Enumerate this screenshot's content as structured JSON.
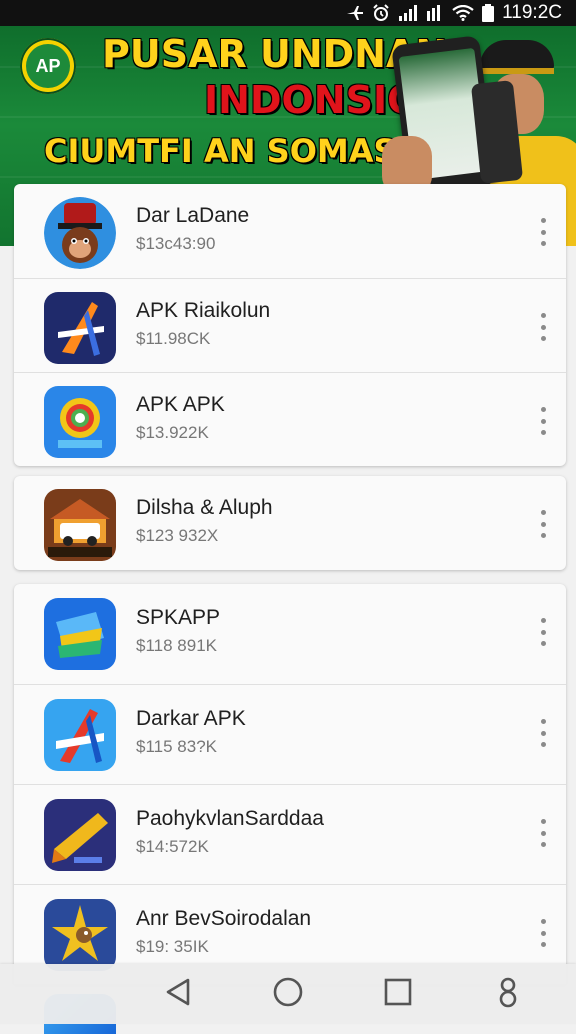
{
  "status_bar": {
    "time": "119:2C",
    "icons": [
      "airplane-icon",
      "alarm-icon",
      "signal-icon",
      "wifi-icon",
      "battery-icon"
    ],
    "background": "#111111"
  },
  "banner": {
    "logo_text": "AP",
    "line1": "PUSAR UNDNAN",
    "line2": "INDONSIO",
    "line3": "CIUMTFI AN SOMASSA!",
    "colors": {
      "background": "#178437",
      "line1": "#ffd21c",
      "line2": "#e0141b",
      "line3": "#ffd21c"
    }
  },
  "apps": [
    {
      "name": "Dar LaDane",
      "size": "$13c43:90",
      "icon": "monkey-hat-icon",
      "colors": [
        "#2f8fe0",
        "#7a3c1c"
      ]
    },
    {
      "name": "APK Riaikolun",
      "size": "$11.98CK",
      "icon": "arrow-a-icon",
      "colors": [
        "#1f2a6b",
        "#ff8a1c"
      ]
    },
    {
      "name": "APK APK",
      "size": "$13.922K",
      "icon": "chrome-ring-icon",
      "colors": [
        "#2a86e8",
        "#f2c618"
      ]
    },
    {
      "name": "Dilsha & Aluph",
      "size": "$123 932X",
      "icon": "truck-icon",
      "colors": [
        "#7a3c1a",
        "#f0a030"
      ]
    },
    {
      "name": "SPKAPP",
      "size": "$118 891K",
      "icon": "folder-fold-icon",
      "colors": [
        "#1e6fe0",
        "#f2c618"
      ]
    },
    {
      "name": "Darkar APK",
      "size": "$115 83?K",
      "icon": "arrow-a-blue-icon",
      "colors": [
        "#36a4f0",
        "#e53a2a"
      ]
    },
    {
      "name": "PaohykvlanSarddaa",
      "size": "$14:572K",
      "icon": "pencil-star-icon",
      "colors": [
        "#2b2f7a",
        "#f0b81c"
      ]
    },
    {
      "name": "Anr BevSoirodalan",
      "size": "$19: 35IK",
      "icon": "star-bird-icon",
      "colors": [
        "#2a4a9a",
        "#f0c020"
      ]
    }
  ],
  "nav": {
    "buttons": [
      "back-icon",
      "home-icon",
      "recents-icon",
      "assistant-icon"
    ]
  }
}
